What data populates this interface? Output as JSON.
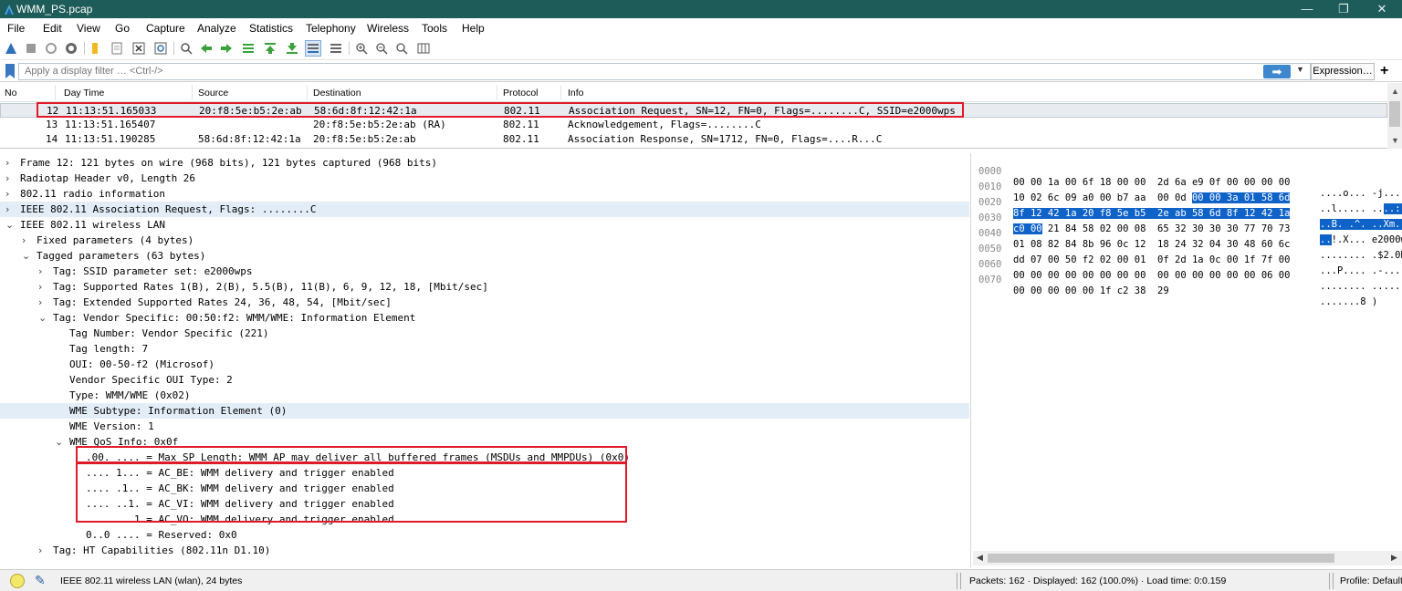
{
  "window": {
    "title": "WMM_PS.pcap",
    "minimize": "—",
    "maximize": "❐",
    "close": "✕"
  },
  "menu": [
    "File",
    "Edit",
    "View",
    "Go",
    "Capture",
    "Analyze",
    "Statistics",
    "Telephony",
    "Wireless",
    "Tools",
    "Help"
  ],
  "toolbar_icons": [
    "shark-fin-start-icon",
    "stop-icon",
    "restart-icon",
    "capture-options-icon",
    "open-file-icon",
    "save-file-icon",
    "close-file-icon",
    "reload-icon",
    "find-icon",
    "go-back-icon",
    "go-forward-icon",
    "go-to-packet-icon",
    "go-first-icon",
    "go-last-icon",
    "autoscroll-icon",
    "colorize-icon",
    "zoom-in-icon",
    "zoom-out-icon",
    "zoom-reset-icon",
    "resize-columns-icon"
  ],
  "filter": {
    "placeholder": "Apply a display filter … <Ctrl-/>",
    "apply": "➡",
    "dropdown": "▼",
    "expression": "Expression…",
    "add": "+"
  },
  "packet_list": {
    "columns": [
      "No",
      "Day Time",
      "Source",
      "Destination",
      "Protocol",
      "Info"
    ],
    "rows": [
      {
        "no": "12",
        "time": "11:13:51.165033",
        "source": "20:f8:5e:b5:2e:ab",
        "destination": "58:6d:8f:12:42:1a",
        "protocol": "802.11",
        "info": "Association Request, SN=12, FN=0, Flags=........C, SSID=e2000wps"
      },
      {
        "no": "13",
        "time": "11:13:51.165407",
        "source": "",
        "destination": "20:f8:5e:b5:2e:ab (RA)",
        "protocol": "802.11",
        "info": "Acknowledgement, Flags=........C"
      },
      {
        "no": "14",
        "time": "11:13:51.190285",
        "source": "58:6d:8f:12:42:1a",
        "destination": "20:f8:5e:b5:2e:ab",
        "protocol": "802.11",
        "info": "Association Response, SN=1712, FN=0, Flags=....R...C"
      }
    ]
  },
  "details": [
    {
      "arrow": "›",
      "text": "Frame 12: 121 bytes on wire (968 bits), 121 bytes captured (968 bits)"
    },
    {
      "arrow": "›",
      "text": "Radiotap Header v0, Length 26"
    },
    {
      "arrow": "›",
      "text": "802.11 radio information"
    },
    {
      "arrow": "›",
      "text": "IEEE 802.11 Association Request, Flags: ........C"
    },
    {
      "arrow": "⌄",
      "text": "IEEE 802.11 wireless LAN"
    },
    {
      "arrow": "›",
      "text": "Fixed parameters (4 bytes)"
    },
    {
      "arrow": "⌄",
      "text": "Tagged parameters (63 bytes)"
    },
    {
      "arrow": "›",
      "text": "Tag: SSID parameter set: e2000wps"
    },
    {
      "arrow": "›",
      "text": "Tag: Supported Rates 1(B), 2(B), 5.5(B), 11(B), 6, 9, 12, 18, [Mbit/sec]"
    },
    {
      "arrow": "›",
      "text": "Tag: Extended Supported Rates 24, 36, 48, 54, [Mbit/sec]"
    },
    {
      "arrow": "⌄",
      "text": "Tag: Vendor Specific: 00:50:f2: WMM/WME: Information Element"
    },
    {
      "arrow": "",
      "text": "Tag Number: Vendor Specific (221)"
    },
    {
      "arrow": "",
      "text": "Tag length: 7"
    },
    {
      "arrow": "",
      "text": "OUI: 00-50-f2 (Microsof)"
    },
    {
      "arrow": "",
      "text": "Vendor Specific OUI Type: 2"
    },
    {
      "arrow": "",
      "text": "Type: WMM/WME (0x02)"
    },
    {
      "arrow": "",
      "text": "WME Subtype: Information Element (0)"
    },
    {
      "arrow": "",
      "text": "WME Version: 1"
    },
    {
      "arrow": "⌄",
      "text": "WME QoS Info: 0x0f"
    },
    {
      "arrow": "",
      "text": ".00. .... = Max SP Length: WMM AP may deliver all buffered frames (MSDUs and MMPDUs) (0x0)"
    },
    {
      "arrow": "",
      "text": ".... 1... = AC_BE: WMM delivery and trigger enabled"
    },
    {
      "arrow": "",
      "text": ".... .1.. = AC_BK: WMM delivery and trigger enabled"
    },
    {
      "arrow": "",
      "text": ".... ..1. = AC_VI: WMM delivery and trigger enabled"
    },
    {
      "arrow": "",
      "text": ".... ...1 = AC_VO: WMM delivery and trigger enabled"
    },
    {
      "arrow": "",
      "text": "0..0 .... = Reserved: 0x0"
    },
    {
      "arrow": "›",
      "text": "Tag: HT Capabilities (802.11n D1.10)"
    }
  ],
  "hex": [
    {
      "offset": "0000",
      "hex": "00 00 1a 00 6f 18 00 00  2d 6a e9 0f 00 00 00 00",
      "ascii": "....o... -j......"
    },
    {
      "offset": "0010",
      "hex": "10 02 6c 09 a0 00 b7 aa  00 0d 00 00 3a 01 58 6d",
      "ascii": "..l..... ....:.Xm"
    },
    {
      "offset": "0020",
      "hex": "8f 12 42 1a 20 f8 5e b5  2e ab 58 6d 8f 12 42 1a",
      "ascii": "..B. .^. ..Xm..B."
    },
    {
      "offset": "0030",
      "hex": "c0 00 21 84 58 02 00 08  65 32 30 30 30 77 70 73",
      "ascii": "..!.X... e2000wps"
    },
    {
      "offset": "0040",
      "hex": "01 08 82 84 8b 96 0c 12  18 24 32 04 30 48 60 6c",
      "ascii": "........ .$2.0H`l"
    },
    {
      "offset": "0050",
      "hex": "dd 07 00 50 f2 02 00 01  0f 2d 1a 0c 00 1f 7f 00",
      "ascii": "...P.... .-......"
    },
    {
      "offset": "0060",
      "hex": "00 00 00 00 00 00 00 00  00 00 00 00 00 00 06 00",
      "ascii": "........ ........"
    },
    {
      "offset": "0070",
      "hex": "00 00 00 00 00 1f c2 38  29",
      "ascii": ".......8 )"
    }
  ],
  "status": {
    "field_info": "IEEE 802.11 wireless LAN (wlan), 24 bytes",
    "packets": "Packets: 162 · Displayed: 162 (100.0%) · Load time: 0:0.159",
    "profile": "Profile: Default"
  },
  "colors": {
    "titlebar": "#1d5c58",
    "selection": "#0f62c8",
    "annotation": "#e0192b",
    "highlight_row": "#e3edf7"
  }
}
